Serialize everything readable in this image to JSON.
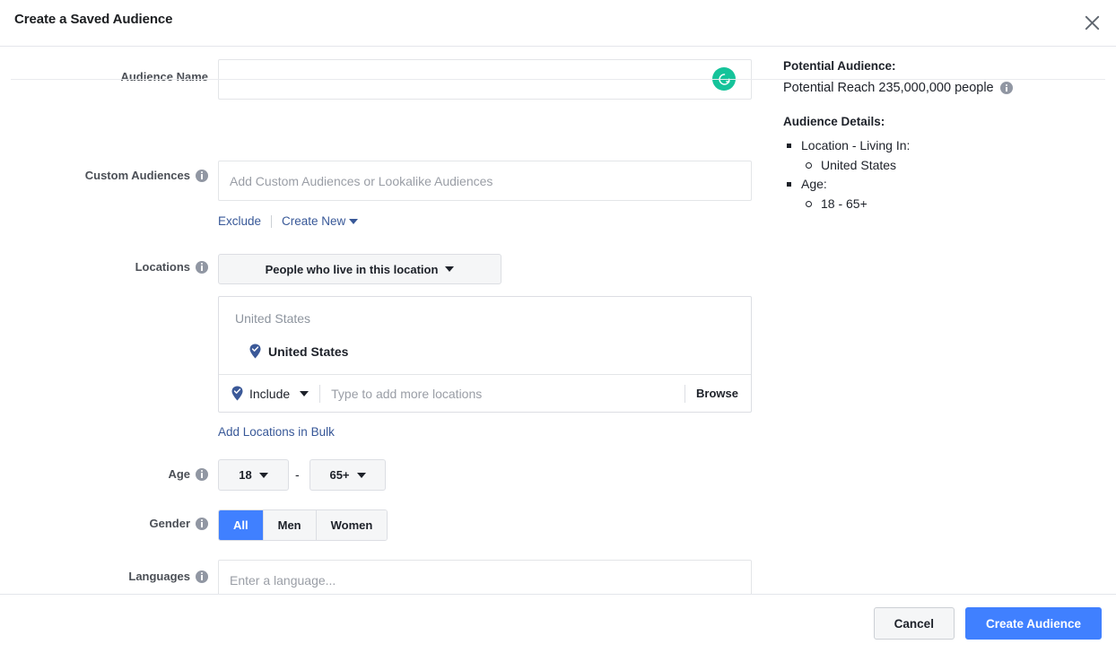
{
  "header": {
    "title": "Create a Saved Audience",
    "close_icon": "close-icon"
  },
  "form": {
    "audience_name": {
      "label": "Audience Name",
      "value": "",
      "placeholder": "",
      "badge_icon": "grammarly-icon"
    },
    "custom_audiences": {
      "label": "Custom Audiences",
      "info_icon": "info-icon",
      "value": "",
      "placeholder": "Add Custom Audiences or Lookalike Audiences",
      "exclude_link": "Exclude",
      "create_new_link": "Create New"
    },
    "locations": {
      "label": "Locations",
      "info_icon": "info-icon",
      "scope_dropdown": "People who live in this location",
      "group_header": "United States",
      "selected": [
        {
          "name": "United States",
          "pin_icon": "location-pin-check-icon"
        }
      ],
      "include_label": "Include",
      "include_icon": "location-pin-check-icon",
      "typeahead_placeholder": "Type to add more locations",
      "typeahead_value": "",
      "browse_label": "Browse",
      "bulk_link": "Add Locations in Bulk"
    },
    "age": {
      "label": "Age",
      "info_icon": "info-icon",
      "min": "18",
      "separator": "-",
      "max": "65+"
    },
    "gender": {
      "label": "Gender",
      "info_icon": "info-icon",
      "options": [
        "All",
        "Men",
        "Women"
      ],
      "selected": "All"
    },
    "languages": {
      "label": "Languages",
      "info_icon": "info-icon",
      "value": "",
      "placeholder": "Enter a language..."
    }
  },
  "sidebar": {
    "potential_audience_heading": "Potential Audience:",
    "reach_text": "Potential Reach 235,000,000 people",
    "reach_info_icon": "info-icon",
    "audience_details_heading": "Audience Details:",
    "details": [
      {
        "label": "Location - Living In:",
        "children": [
          "United States"
        ]
      },
      {
        "label": "Age:",
        "children": [
          "18 - 65+"
        ]
      }
    ]
  },
  "footer": {
    "cancel_label": "Cancel",
    "submit_label": "Create Audience"
  },
  "colors": {
    "primary_blue": "#4080ff",
    "link_blue": "#385898",
    "pin_blue": "#3b5998",
    "grammarly_green": "#15c39a",
    "text_dark": "#1d2129",
    "label_gray": "#4b4f56",
    "placeholder_gray": "#9a9ea6"
  }
}
